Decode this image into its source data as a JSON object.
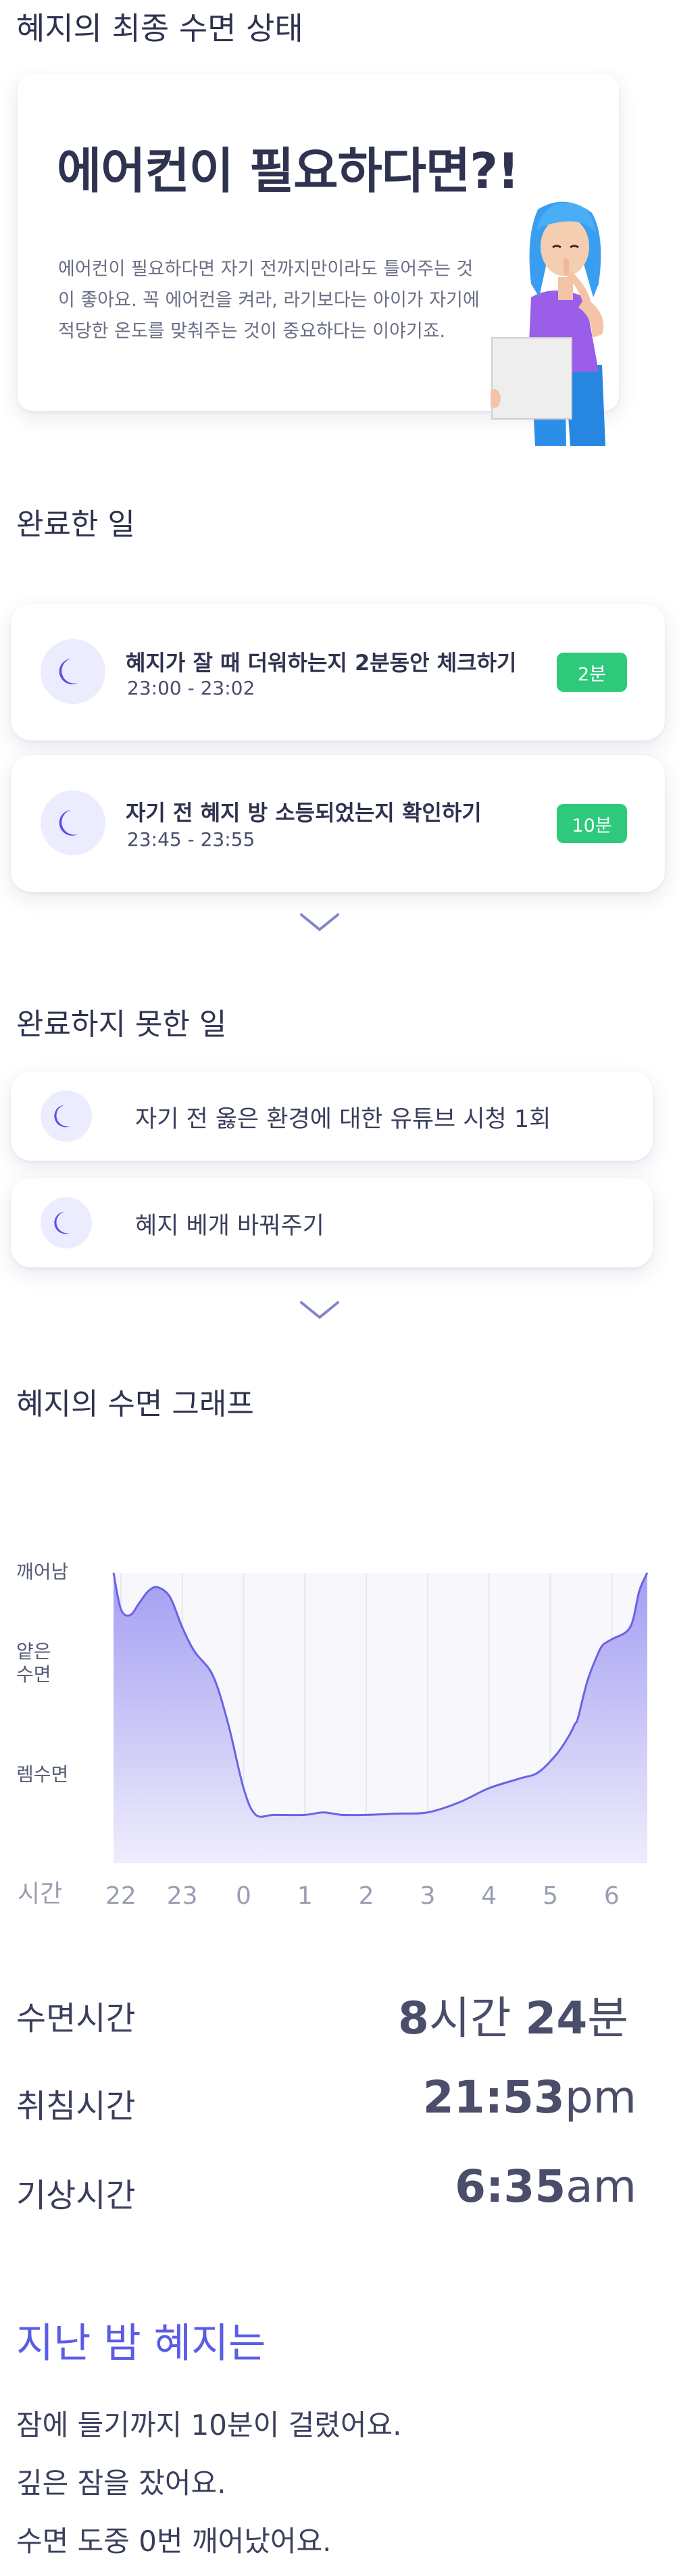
{
  "header": {
    "title": "혜지의 최종 수면 상태"
  },
  "tip_card": {
    "title": "에어컨이 필요하다면?!",
    "body_lines": [
      "에어컨이 필요하다면 자기 전까지만이라도 틀어주는 것",
      "이 좋아요. 꼭 에어컨을 켜라, 라기보다는 아이가 자기에",
      "적당한 온도를 맞춰주는 것이 중요하다는 이야기죠."
    ]
  },
  "completed": {
    "title": "완료한 일",
    "items": [
      {
        "icon": "moon-icon",
        "title": "혜지가 잘 때 더워하는지 2분동안 체크하기",
        "time": "23:00 - 23:02",
        "badge": "2분"
      },
      {
        "icon": "moon-icon",
        "title": "자기 전 혜지 방 소등되었는지 확인하기",
        "time": "23:45 - 23:55",
        "badge": "10분"
      }
    ],
    "expand_icon": "chevron-down-icon"
  },
  "incomplete": {
    "title": "완료하지 못한 일",
    "items": [
      {
        "icon": "moon-icon",
        "title": "자기 전 옳은 환경에 대한 유튜브 시청 1회"
      },
      {
        "icon": "moon-icon",
        "title": "혜지 베개 바꿔주기"
      }
    ],
    "expand_icon": "chevron-down-icon"
  },
  "graph": {
    "title": "혜지의 수면 그래프",
    "y_labels": [
      "깨어남",
      "얕은 수면",
      "렘수면"
    ],
    "x_axis_label": "시간",
    "colors": {
      "line": "#6a63e6",
      "fill_top": "#a49ef2",
      "fill_bottom": "#eeedfc",
      "grid": "#e6e7ef"
    }
  },
  "chart_data": {
    "type": "area",
    "x_axis_label": "시간",
    "x_ticks": [
      "22",
      "23",
      "0",
      "1",
      "2",
      "3",
      "4",
      "5",
      "6"
    ],
    "y_categories": [
      "렘수면",
      "얕은 수면",
      "깨어남"
    ],
    "series": [
      {
        "x": [
          21.88,
          22.0,
          22.15,
          22.3,
          22.45,
          22.6,
          22.8,
          23.0,
          23.2,
          23.5,
          23.75,
          24.0,
          24.2,
          24.5,
          25.0,
          25.3,
          25.6,
          26.0,
          26.5,
          27.0,
          27.5,
          28.0,
          28.5,
          28.8,
          29.1,
          29.3,
          29.4,
          29.45,
          29.6,
          29.75,
          29.85,
          30.0,
          30.3,
          30.45,
          30.58
        ],
        "values": [
          2.0,
          1.7,
          1.65,
          1.75,
          1.85,
          1.88,
          1.8,
          1.55,
          1.35,
          1.15,
          0.75,
          0.22,
          0.0,
          0.0,
          0.0,
          0.02,
          0.0,
          0.0,
          0.01,
          0.02,
          0.1,
          0.22,
          0.3,
          0.35,
          0.5,
          0.65,
          0.75,
          0.8,
          1.1,
          1.3,
          1.4,
          1.45,
          1.55,
          1.85,
          2.0
        ]
      }
    ],
    "xlim": [
      21.88,
      30.58
    ],
    "ylim": [
      -0.4,
      2.0
    ],
    "grid": true
  },
  "stats": [
    {
      "label": "수면시간",
      "num1": "8",
      "unit1": "시간 ",
      "num2": "24",
      "unit2": "분"
    },
    {
      "label": "취침시간",
      "num1": "21:53",
      "unit1": "pm",
      "num2": "",
      "unit2": ""
    },
    {
      "label": "기상시간",
      "num1": "6:35",
      "unit1": "am",
      "num2": "",
      "unit2": ""
    }
  ],
  "summary": {
    "title": "지난 밤 혜지는",
    "title_color": "#5b5ce6",
    "lines": [
      "잠에 들기까지 10분이 걸렸어요.",
      "깊은 잠을 잤어요.",
      "수면 도중 0번 깨어났어요."
    ]
  }
}
